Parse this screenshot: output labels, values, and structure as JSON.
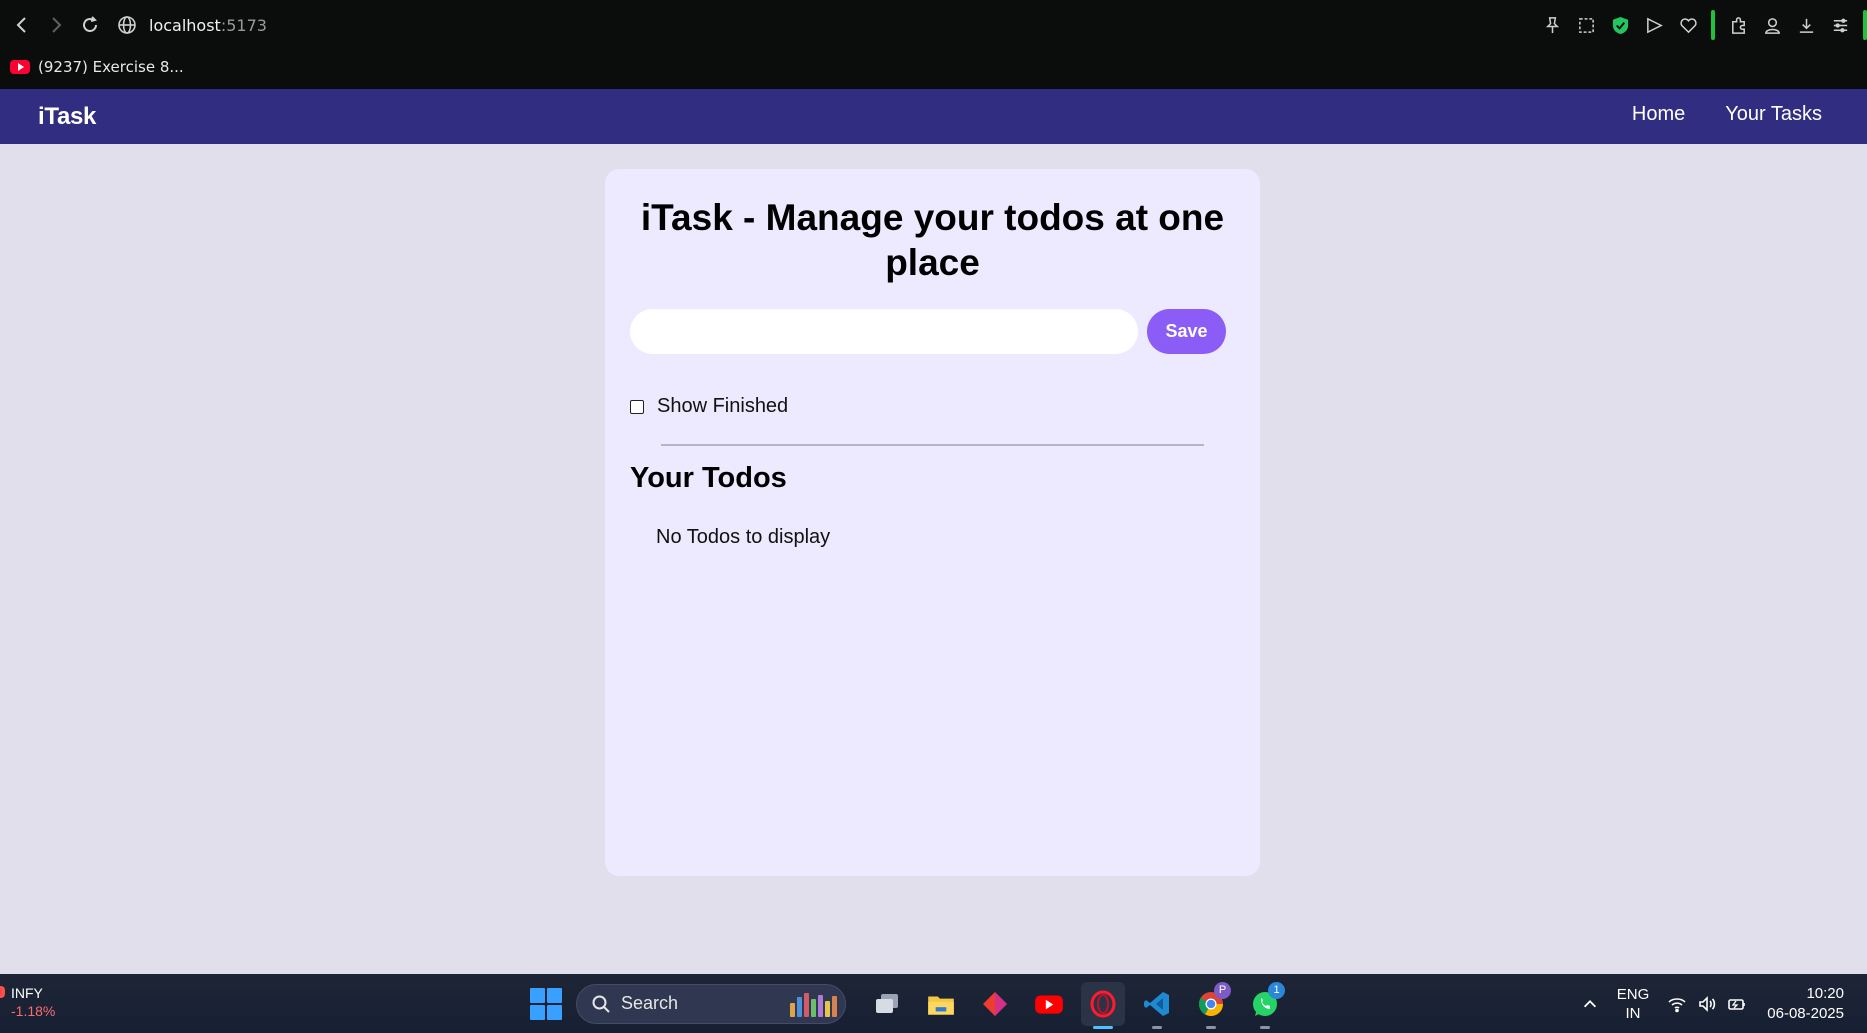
{
  "browser": {
    "url_host": "localhost",
    "url_port": ":5173",
    "bookmark_label": "(9237) Exercise 8..."
  },
  "app": {
    "brand": "iTask",
    "nav": [
      "Home",
      "Your Tasks"
    ],
    "title": "iTask - Manage your todos at one place",
    "input": {
      "value": "",
      "placeholder": ""
    },
    "save_label": "Save",
    "show_finished_label": "Show Finished",
    "show_finished_checked": false,
    "todos_heading": "Your Todos",
    "empty_message": "No Todos to display",
    "colors": {
      "nav_bg": "#312e81",
      "card_bg": "#ede9fe",
      "save_bg": "#8b5cf6",
      "page_bg": "#e1dfec"
    }
  },
  "taskbar": {
    "ticker_symbol": "INFY",
    "ticker_change": "-1.18%",
    "search_label": "Search",
    "apps": [
      "task-view",
      "file-explorer",
      "git-client",
      "youtube",
      "opera",
      "vscode",
      "chrome",
      "whatsapp"
    ],
    "chrome_badge": "P",
    "whatsapp_badge": "1",
    "lang_line1": "ENG",
    "lang_line2": "IN",
    "time": "10:20",
    "date": "06-08-2025"
  }
}
